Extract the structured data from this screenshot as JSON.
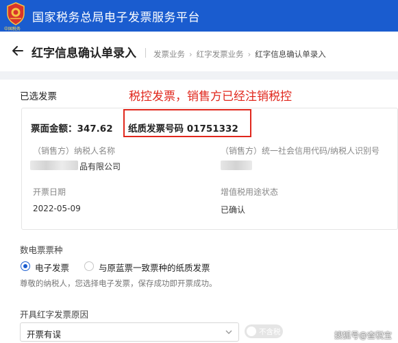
{
  "topbar": {
    "emblem_text": "中国税务",
    "title": "国家税务总局电子发票服务平台"
  },
  "header": {
    "page_title": "红字信息确认单录入",
    "breadcrumb": [
      "发票业务",
      "红字发票业务",
      "红字信息确认单录入"
    ]
  },
  "annotation": "税控发票，销售方已经注销税控",
  "selected_invoice": {
    "section_title": "已选发票",
    "amount_text": "票面金额：347.62",
    "paper_number_text": "纸质发票号码 01751332",
    "seller_name_label": "（销售方）纳税人名称",
    "seller_name_value": "品有限公司",
    "seller_id_label": "（销售方）统一社会信用代码/纳税人识别号",
    "seller_id_value": "",
    "issue_date_label": "开票日期",
    "issue_date_value": "2022-05-09",
    "vat_status_label": "增值税用途状态",
    "vat_status_value": "已确认"
  },
  "invoice_type": {
    "label": "数电票票种",
    "options": [
      "电子发票",
      "与原蓝票一致票种的纸质发票"
    ],
    "selected": "电子发票",
    "hint": "尊敬的纳税人，您选择电子发票，保存成功即开票成功。"
  },
  "reason": {
    "label": "开具红字发票原因",
    "value": "开票有误",
    "toggle_label": "不含税"
  },
  "watermark": "搜狐号@查税宝",
  "colors": {
    "brand_blue": "#1a5ccf",
    "annotation_red": "#e0261b"
  }
}
